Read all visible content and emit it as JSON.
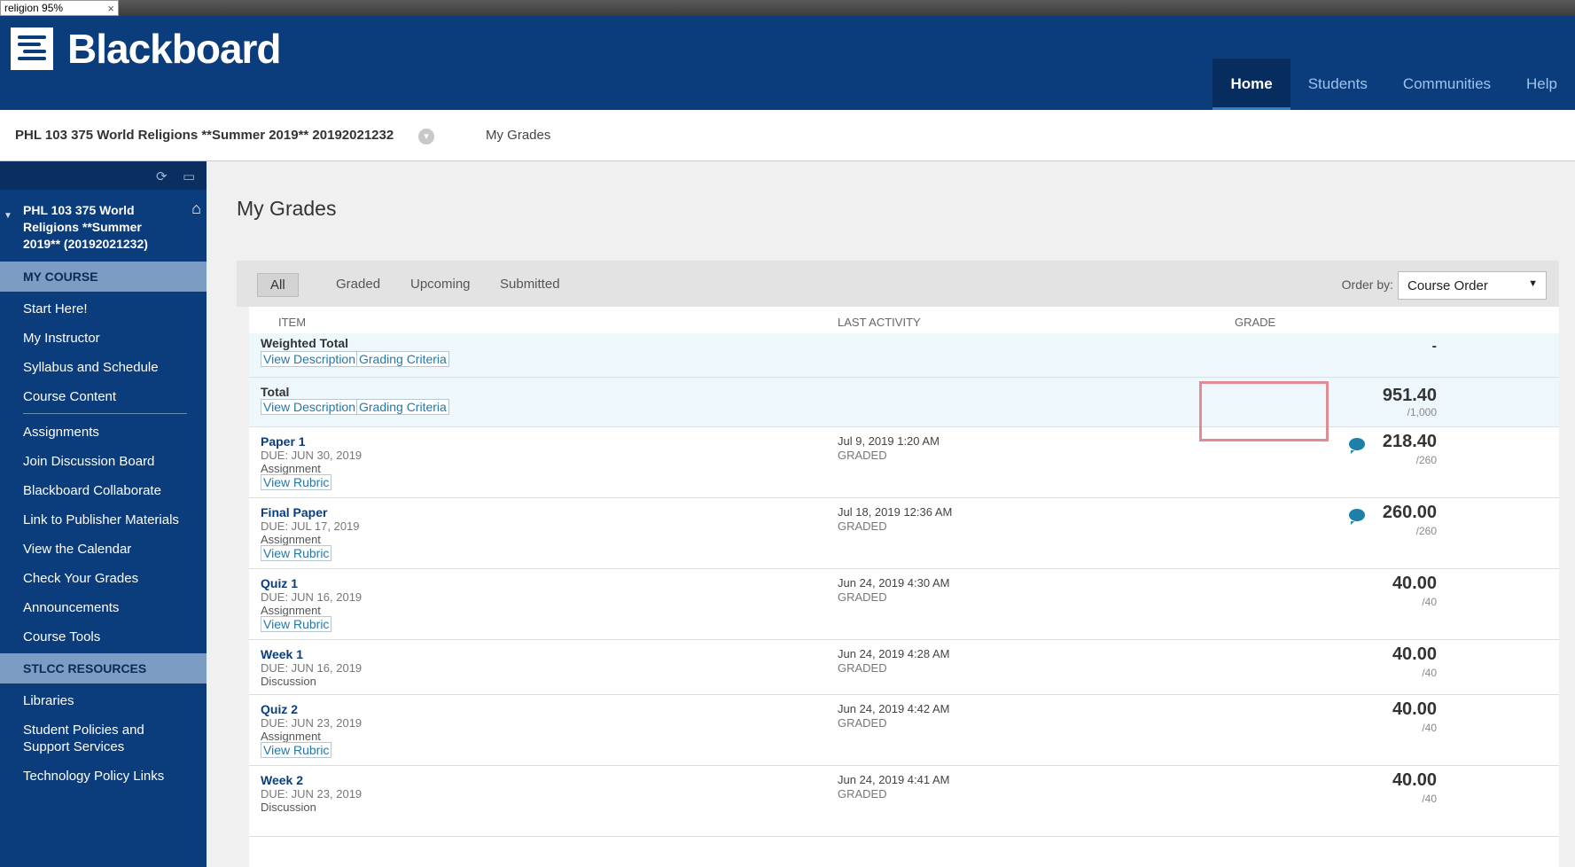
{
  "browser": {
    "tab_title": "religion 95%",
    "tab_close": "×"
  },
  "header": {
    "logo_text": "Blackboard",
    "nav": [
      {
        "label": "Home",
        "active": true
      },
      {
        "label": "Students",
        "active": false
      },
      {
        "label": "Communities",
        "active": false
      },
      {
        "label": "Help",
        "active": false
      }
    ]
  },
  "breadcrumb": {
    "course": "PHL 103 375 World Religions **Summer 2019** 20192021232",
    "current": "My Grades"
  },
  "sidebar": {
    "course_title": "PHL 103 375 World Religions **Summer 2019** (20192021232)",
    "section_my_course": "MY COURSE",
    "items_group1": [
      "Start Here!",
      "My Instructor",
      "Syllabus and Schedule",
      "Course Content"
    ],
    "items_group2": [
      "Assignments",
      "Join Discussion Board",
      "Blackboard Collaborate",
      "Link to Publisher Materials",
      "View the Calendar",
      "Check Your Grades",
      "Announcements",
      "Course Tools"
    ],
    "section_resources": "STLCC RESOURCES",
    "items_resources": [
      "Libraries",
      "Student Policies and Support Services",
      "Technology Policy Links"
    ]
  },
  "main": {
    "title": "My Grades",
    "filters": [
      "All",
      "Graded",
      "Upcoming",
      "Submitted"
    ],
    "active_filter": "All",
    "order_by_label": "Order by:",
    "order_by_value": "Course Order",
    "columns": {
      "item": "ITEM",
      "activity": "LAST ACTIVITY",
      "grade": "GRADE"
    },
    "summary_rows": [
      {
        "name": "Weighted Total",
        "link1": "View Description",
        "link2": "Grading Criteria",
        "grade": "-",
        "max": ""
      },
      {
        "name": "Total",
        "link1": "View Description",
        "link2": "Grading Criteria",
        "grade": "951.40",
        "max": "/1,000"
      }
    ],
    "rows": [
      {
        "name": "Paper 1",
        "due": "DUE: JUN 30, 2019",
        "type": "Assignment",
        "link": "View Rubric",
        "date": "Jul 9, 2019 1:20 AM",
        "status": "GRADED",
        "grade": "218.40",
        "max": "/260",
        "comment": true
      },
      {
        "name": "Final Paper",
        "due": "DUE: JUL 17, 2019",
        "type": "Assignment",
        "link": "View Rubric",
        "date": "Jul 18, 2019 12:36 AM",
        "status": "GRADED",
        "grade": "260.00",
        "max": "/260",
        "comment": true
      },
      {
        "name": "Quiz 1",
        "due": "DUE: JUN 16, 2019",
        "type": "Assignment",
        "link": "View Rubric",
        "date": "Jun 24, 2019 4:30 AM",
        "status": "GRADED",
        "grade": "40.00",
        "max": "/40",
        "comment": false
      },
      {
        "name": "Week 1",
        "due": "DUE: JUN 16, 2019",
        "type": "Discussion",
        "link": "",
        "date": "Jun 24, 2019 4:28 AM",
        "status": "GRADED",
        "grade": "40.00",
        "max": "/40",
        "comment": false
      },
      {
        "name": "Quiz 2",
        "due": "DUE: JUN 23, 2019",
        "type": "Assignment",
        "link": "View Rubric",
        "date": "Jun 24, 2019 4:42 AM",
        "status": "GRADED",
        "grade": "40.00",
        "max": "/40",
        "comment": false
      },
      {
        "name": "Week 2",
        "due": "DUE: JUN 23, 2019",
        "type": "Discussion",
        "link": "",
        "date": "Jun 24, 2019 4:41 AM",
        "status": "GRADED",
        "grade": "40.00",
        "max": "/40",
        "comment": false
      }
    ]
  }
}
